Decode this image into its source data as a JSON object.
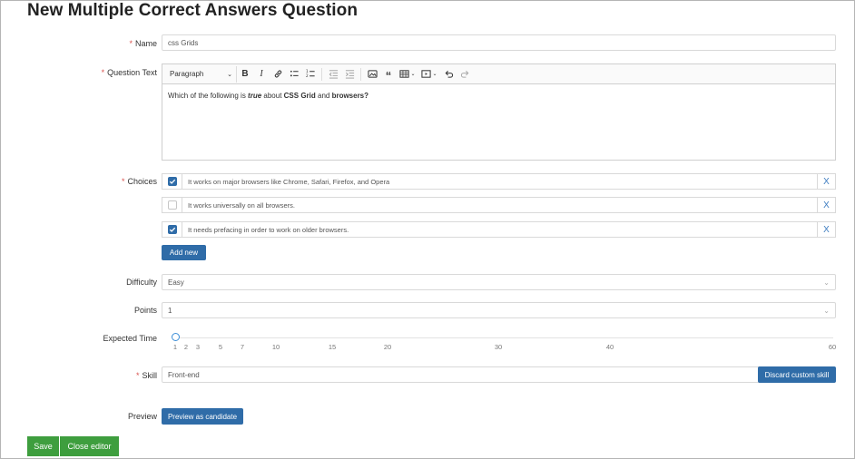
{
  "page": {
    "title": "New Multiple Correct Answers Question"
  },
  "name": {
    "label": "Name",
    "value": "css Grids"
  },
  "question_text": {
    "label": "Question Text",
    "toolbar": {
      "paragraph_label": "Paragraph"
    },
    "content": {
      "prefix": "Which of the following is ",
      "em": "true",
      "middle": " about ",
      "strong1": "CSS Grid",
      "and": " and ",
      "strong2": "browsers?"
    }
  },
  "choices": {
    "label": "Choices",
    "items": [
      {
        "text": "It works on major browsers like Chrome, Safari, Firefox, and Opera",
        "checked": true
      },
      {
        "text": "It works universally on all browsers.",
        "checked": false
      },
      {
        "text": "It needs prefacing in order to work on older browsers.",
        "checked": true
      }
    ],
    "remove_label": "X",
    "add_new_label": "Add new"
  },
  "difficulty": {
    "label": "Difficulty",
    "value": "Easy"
  },
  "points": {
    "label": "Points",
    "value": "1"
  },
  "expected_time": {
    "label": "Expected Time",
    "value": 1,
    "ticks": [
      "1",
      "2",
      "3",
      "5",
      "7",
      "10",
      "15",
      "20",
      "30",
      "40",
      "60"
    ]
  },
  "skill": {
    "label": "Skill",
    "value": "Front-end",
    "discard_label": "Discard custom skill"
  },
  "preview": {
    "label": "Preview",
    "button_label": "Preview as candidate"
  },
  "footer": {
    "save_label": "Save",
    "close_label": "Close editor"
  },
  "colors": {
    "primary": "#2f6ca8",
    "success": "#3e9e3e",
    "required": "#d9534f",
    "slider_handle": "#3d8fd8"
  }
}
